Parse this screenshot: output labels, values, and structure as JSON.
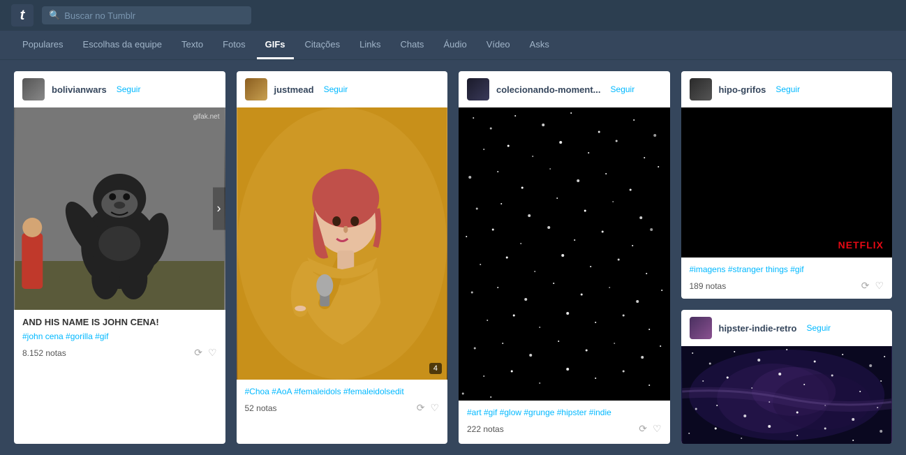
{
  "app": {
    "logo": "t",
    "search_placeholder": "Buscar no Tumblr"
  },
  "navbar": {
    "items": [
      {
        "label": "Populares",
        "active": false
      },
      {
        "label": "Escolhas da equipe",
        "active": false
      },
      {
        "label": "Texto",
        "active": false
      },
      {
        "label": "Fotos",
        "active": false
      },
      {
        "label": "GIFs",
        "active": true
      },
      {
        "label": "Citações",
        "active": false
      },
      {
        "label": "Links",
        "active": false
      },
      {
        "label": "Chats",
        "active": false
      },
      {
        "label": "Áudio",
        "active": false
      },
      {
        "label": "Vídeo",
        "active": false
      },
      {
        "label": "Asks",
        "active": false
      }
    ]
  },
  "posts": [
    {
      "username": "bolivianwars",
      "follow_label": "Seguir",
      "watermark": "gifak.net",
      "has_nav": true,
      "image_type": "gorilla",
      "title": "AND HIS NAME IS JOHN CENA!",
      "tags": "#john cena  #gorilla  #gif",
      "notes": "8.152 notas"
    },
    {
      "username": "justmead",
      "follow_label": "Seguir",
      "image_type": "singer",
      "slide_count": "4",
      "tags": "#Choa  #AoA  #femaleidols  #femaleidolsedit",
      "notes": "52 notas"
    },
    {
      "username": "colecionando-moment...",
      "follow_label": "Seguir",
      "image_type": "space",
      "tags": "#art  #gif  #glow  #grunge  #hipster  #indie",
      "notes": "222 notas"
    },
    {
      "username": "hipo-grifos",
      "follow_label": "Seguir",
      "image_type": "netflix",
      "netflix_text": "NETFLIX",
      "tags_secondary": "#imagens  #stranger things  #gif",
      "notes": "189 notas",
      "second_post": {
        "username": "hipster-indie-retro",
        "follow_label": "Seguir",
        "image_type": "galaxy"
      }
    }
  ],
  "icons": {
    "search": "🔍",
    "reblog": "⟳",
    "like": "♡"
  }
}
